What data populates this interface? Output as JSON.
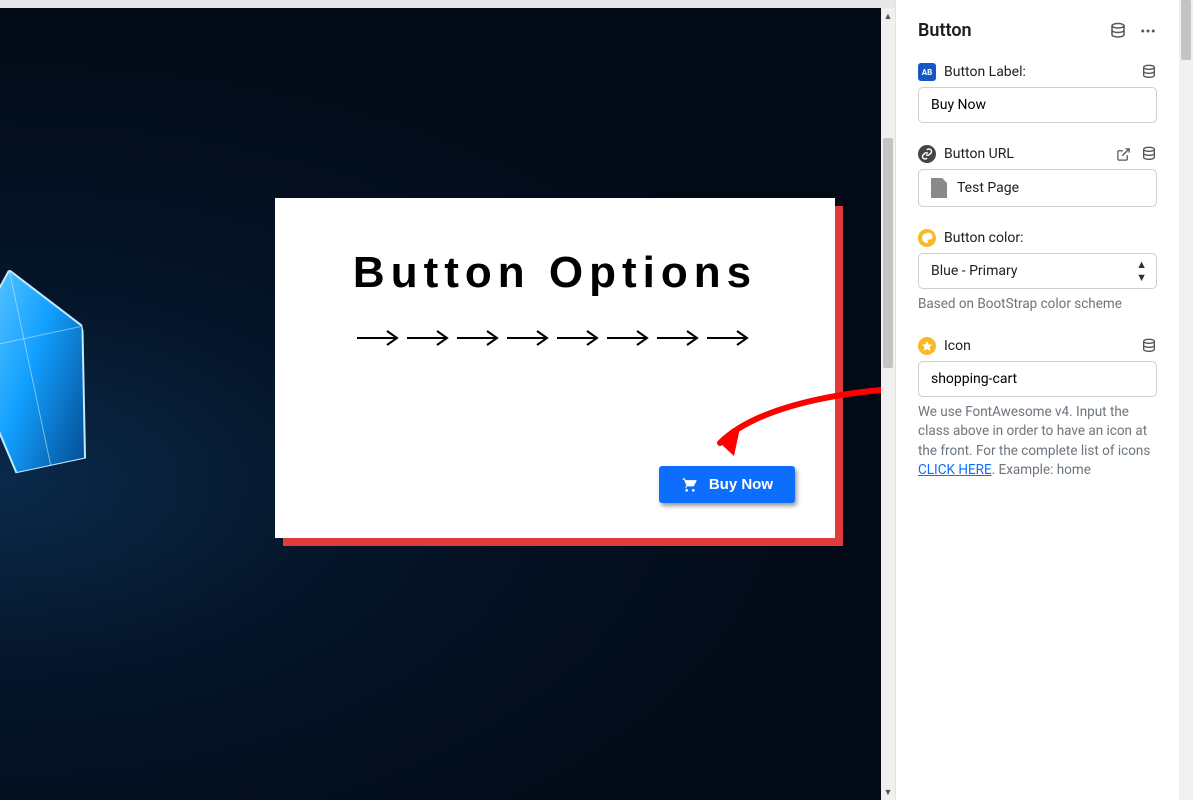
{
  "preview": {
    "card_title": "Button Options",
    "buy_button_label": "Buy Now"
  },
  "sidebar": {
    "block_title": "Button",
    "fields": {
      "label": {
        "title": "Button Label:",
        "value": "Buy Now"
      },
      "url": {
        "title": "Button URL",
        "value": "Test Page"
      },
      "color": {
        "title": "Button color:",
        "selected": "Blue - Primary",
        "help": "Based on BootStrap color scheme"
      },
      "icon": {
        "title": "Icon",
        "value": "shopping-cart",
        "help_pre": "We use FontAwesome v4. Input the class above in order to have an icon at the front. For the complete list of icons ",
        "help_link": "CLICK HERE",
        "help_post": ". Example: home"
      }
    }
  }
}
